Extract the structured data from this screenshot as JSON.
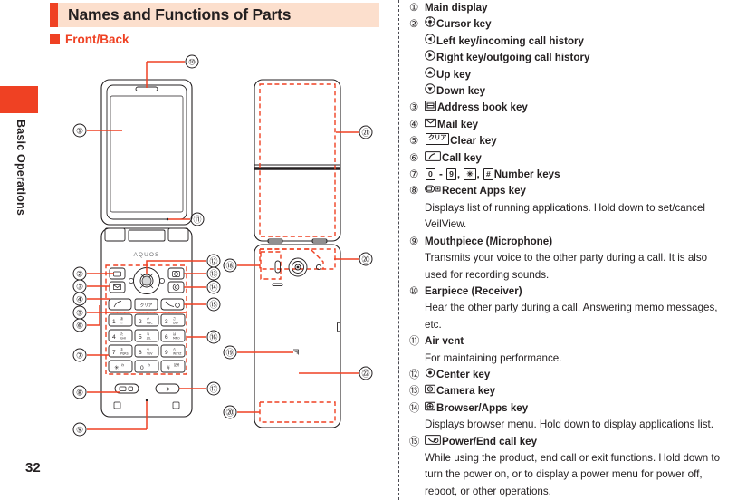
{
  "page": {
    "number": "32",
    "side_tab_label": "Basic Operations"
  },
  "header": {
    "title": "Names and Functions of Parts",
    "subheading": "Front/Back",
    "accent_color": "#ef4123",
    "banner_color": "#fcdfcd"
  },
  "figure": {
    "brand_text": "AQUOS",
    "front_callouts": [
      "1",
      "2",
      "3",
      "4",
      "5",
      "6",
      "7",
      "8",
      "9",
      "10",
      "11",
      "12",
      "13",
      "14",
      "15",
      "16",
      "17"
    ],
    "back_callouts": [
      "18",
      "19",
      "20",
      "21",
      "22"
    ],
    "keypad_keys": [
      {
        "digit": "1",
        "sub": "あ"
      },
      {
        "digit": "2",
        "sub": "か ABC"
      },
      {
        "digit": "3",
        "sub": "さ DEF"
      },
      {
        "digit": "4",
        "sub": "た GHI"
      },
      {
        "digit": "5",
        "sub": "な JKL"
      },
      {
        "digit": "6",
        "sub": "は MNO"
      },
      {
        "digit": "7",
        "sub": "ま PQRS"
      },
      {
        "digit": "8",
        "sub": "や TUV"
      },
      {
        "digit": "9",
        "sub": "ら WXYZ"
      },
      {
        "digit": "✳",
        "sub": "わ"
      },
      {
        "digit": "0",
        "sub": "わ"
      },
      {
        "digit": "#",
        "sub": "記号"
      }
    ],
    "clear_key_text": "クリア",
    "line_color": "#ef4123",
    "outline_color": "#231f20"
  },
  "legend": {
    "items": [
      {
        "num": "1",
        "icon": null,
        "label": "Main display",
        "desc": null
      },
      {
        "num": "2",
        "icon": "cursor-key-icon",
        "label": "Cursor key",
        "desc": null,
        "subs": [
          {
            "icon": "left-key-icon",
            "label": "Left key/incoming call history"
          },
          {
            "icon": "right-key-icon",
            "label": "Right key/outgoing call history"
          },
          {
            "icon": "up-key-icon",
            "label": "Up key"
          },
          {
            "icon": "down-key-icon",
            "label": "Down key"
          }
        ]
      },
      {
        "num": "3",
        "icon": "address-book-key-icon",
        "label": "Address book key",
        "desc": null
      },
      {
        "num": "4",
        "icon": "mail-key-icon",
        "label": "Mail key",
        "desc": null
      },
      {
        "num": "5",
        "icon": "clear-key-icon",
        "label": "Clear key",
        "desc": null
      },
      {
        "num": "6",
        "icon": "call-key-icon",
        "label": "Call key",
        "desc": null
      },
      {
        "num": "7",
        "icon": "number-keys-icon",
        "label": "Number keys",
        "desc": null,
        "keys": {
          "from": "0",
          "to": "9",
          "star": "✳",
          "hash": "#"
        }
      },
      {
        "num": "8",
        "icon": "recent-apps-key-icon",
        "label": "Recent Apps key",
        "desc": "Displays list of running applications. Hold down to set/cancel VeilView."
      },
      {
        "num": "9",
        "icon": null,
        "label": "Mouthpiece (Microphone)",
        "desc": "Transmits your voice to the other party during a call. It is also used for recording sounds."
      },
      {
        "num": "10",
        "icon": null,
        "label": "Earpiece (Receiver)",
        "desc": "Hear the other party during a call, Answering memo messages, etc."
      },
      {
        "num": "11",
        "icon": null,
        "label": "Air vent",
        "desc": "For maintaining performance."
      },
      {
        "num": "12",
        "icon": "center-key-icon",
        "label": "Center key",
        "desc": null
      },
      {
        "num": "13",
        "icon": "camera-key-icon",
        "label": "Camera key",
        "desc": null
      },
      {
        "num": "14",
        "icon": "browser-apps-key-icon",
        "label": "Browser/Apps key",
        "desc": "Displays browser menu. Hold down to display applications list."
      },
      {
        "num": "15",
        "icon": "power-end-call-key-icon",
        "label": "Power/End call key",
        "desc": "While using the product, end call or exit functions. Hold down to turn the power on, or to display a power menu for power off, reboot, or other operations."
      }
    ]
  }
}
